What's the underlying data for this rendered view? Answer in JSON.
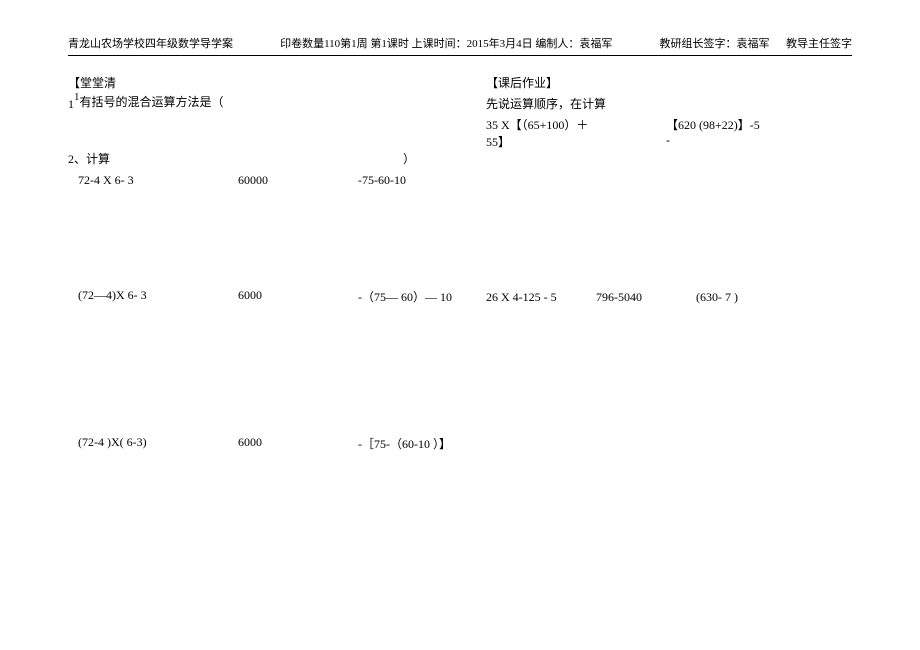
{
  "header": {
    "left": "青龙山农场学校四年级数学导学案",
    "center": "印卷数量110第1周  第1课时  上课时间：2015年3月4日  编制人：袁福军",
    "right1": "教研组长签字：袁福军",
    "right2": "教导主任签字"
  },
  "left_section": {
    "title": "【堂堂清",
    "q1_num": "1",
    "q1_sup": "1",
    "q1_text": "有括号的混合运算方法是（",
    "q2": "2、计算",
    "paren_close": "）",
    "row1": {
      "c1": "72-4 X 6- 3",
      "c2": "60000",
      "c3": "-75-60-10"
    },
    "row2": {
      "c1": "(72—4)X 6- 3",
      "c2": "6000",
      "c3": "-（75— 60）— 10"
    },
    "row3": {
      "c1": "(72-4 )X( 6-3)",
      "c2": "6000",
      "c3": "-［75-（60-10 ）】"
    }
  },
  "right_section": {
    "title": "【课后作业】",
    "sub": "先说运算顺序，在计算",
    "row1": {
      "h1a": "35 X【（65+100）＋",
      "h1b": "55】",
      "h2a": "【620  (98+22)】-5",
      "h2b": "-"
    },
    "row2": {
      "h1": "26 X 4-125 - 5",
      "h2": "796-5040",
      "h3": "(630- 7 )"
    }
  }
}
